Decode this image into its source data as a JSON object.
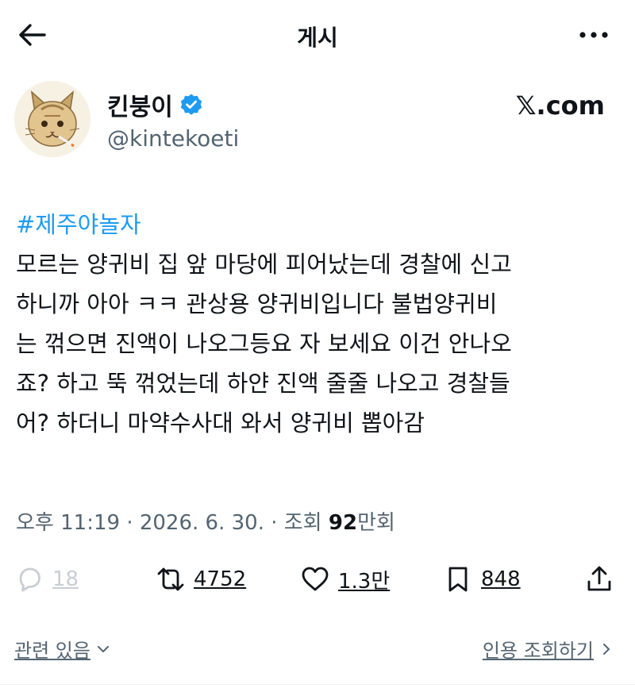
{
  "header": {
    "title": "게시"
  },
  "author": {
    "name": "킨붕이",
    "handle": "@kintekoeti",
    "verified": true,
    "verified_color": "#1d9bf0"
  },
  "source": "𝕏.com",
  "post": {
    "hashtag": "#제주야놀자",
    "lines": [
      "모르는 양귀비 집 앞 마당에 피어났는데 경찰에 신고",
      "하니까 아아 ㅋㅋ 관상용 양귀비입니다 불법양귀비",
      "는 꺾으면 진액이 나오그등요 자 보세요 이건 안나오",
      "죠? 하고 뚝 꺾었는데 하얀 진액 줄줄 나오고 경찰들",
      "어? 하더니 마약수사대 와서 양귀비 뽑아감"
    ]
  },
  "meta": {
    "time": "오후 11:19",
    "separator": "·",
    "date": "2026. 6. 30.",
    "views_label": "조회",
    "views_number": "92",
    "views_unit": "만회"
  },
  "actions": {
    "replies": "18",
    "reposts": "4752",
    "likes": "1.3만",
    "bookmarks": "848"
  },
  "footer": {
    "related_label": "관련 있음",
    "quotes_label": "인용 조회하기"
  },
  "colors": {
    "link_blue": "#1d9bf0",
    "text": "#0f1419",
    "secondary": "#536471"
  }
}
